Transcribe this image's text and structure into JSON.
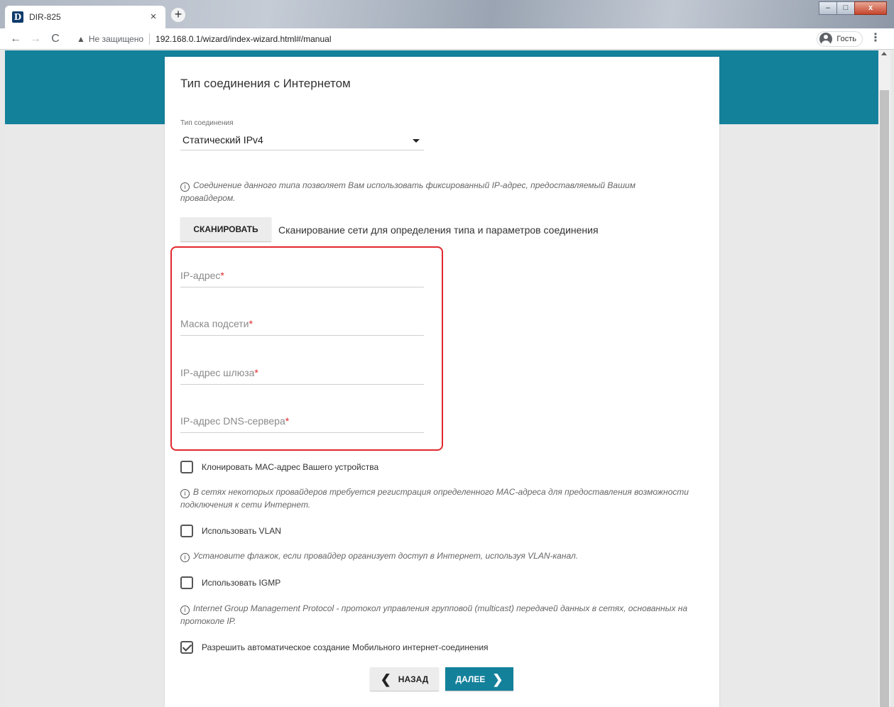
{
  "browser": {
    "tab_title": "DIR-825",
    "tab_favicon": "D",
    "tab_close": "×",
    "new_tab": "+",
    "back": "←",
    "forward": "→",
    "reload": "C",
    "warning_icon": "▲",
    "insecure_label": "Не защищено",
    "url": "192.168.0.1/wizard/index-wizard.html#/manual",
    "profile_label": "Гость",
    "menu": "⋮",
    "window_minimize": "–",
    "window_maximize": "□",
    "window_close": "x"
  },
  "page": {
    "title": "Тип соединения с Интернетом",
    "connection_type": {
      "label": "Тип соединения",
      "value": "Статический IPv4"
    },
    "connection_hint": "Соединение данного типа позволяет Вам использовать фиксированный IP-адрес, предоставляемый Вашим провайдером.",
    "scan_button": "СКАНИРОВАТЬ",
    "scan_text": "Сканирование сети для определения типа и параметров соединения",
    "fields": {
      "ip": "IP-адрес",
      "mask": "Маска подсети",
      "gateway": "IP-адрес шлюза",
      "dns": "IP-адрес DNS-сервера"
    },
    "required_mark": "*",
    "info_glyph": "i",
    "clone_mac": {
      "label": "Клонировать MAC-адрес Вашего устройства",
      "checked": false,
      "hint": "В сетях некоторых провайдеров требуется регистрация определенного MAC-адреса для предоставления возможности подключения к сети Интернет."
    },
    "vlan": {
      "label": "Использовать VLAN",
      "checked": false,
      "hint": "Установите флажок, если провайдер организует доступ в Интернет, используя VLAN-канал."
    },
    "igmp": {
      "label": "Использовать IGMP",
      "checked": false,
      "hint": "Internet Group Management Protocol - протокол управления групповой (multicast) передачей данных в сетях, основанных на протоколе IP."
    },
    "mobile": {
      "label": "Разрешить автоматическое создание Мобильного интернет-соединения",
      "checked": true
    },
    "back_button": "НАЗАД",
    "next_button": "ДАЛЕЕ",
    "chevron_left": "❮",
    "chevron_right": "❯"
  },
  "colors": {
    "brand": "#14819b",
    "highlight": "#e0282d",
    "required": "#e0282d"
  }
}
